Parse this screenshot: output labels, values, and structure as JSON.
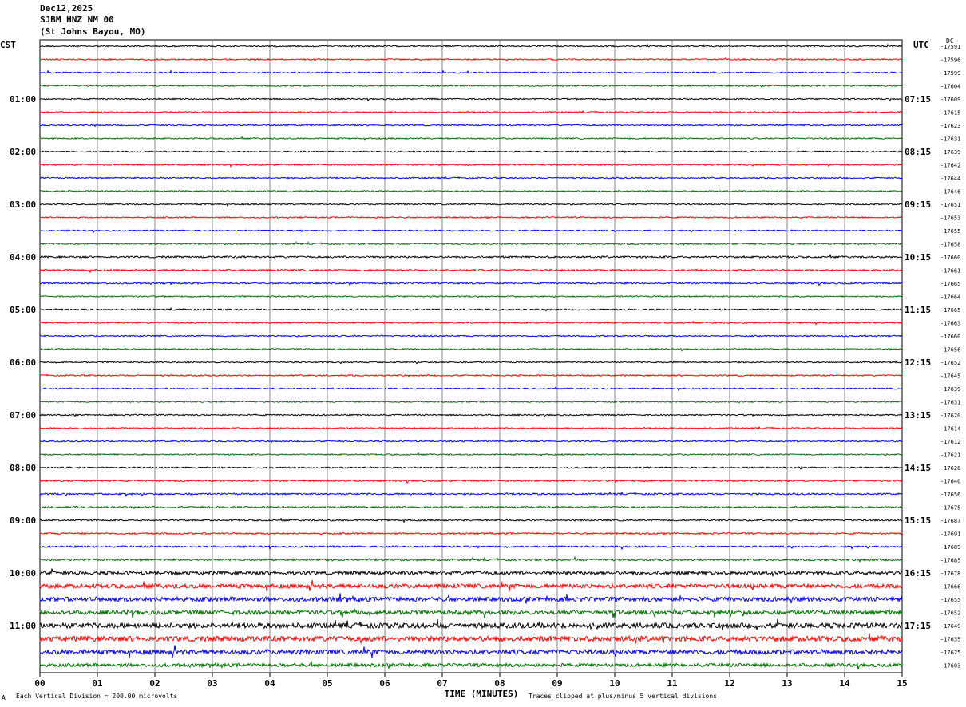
{
  "header": {
    "date": "Dec12,2025",
    "station": "SJBM HNZ NM 00",
    "location": "(St Johns Bayou, MO)"
  },
  "left_tz": "CST",
  "right_tz": "UTC",
  "right_corner_note": "DC",
  "footer": {
    "mark": "A",
    "scale": "Each Vertical Division =  200.00 microvolts",
    "xlabel": "TIME (MINUTES)",
    "clip": "Traces clipped at plus/minus 5 vertical divisions"
  },
  "chart_data": {
    "type": "line",
    "title": "",
    "x_ticks": [
      "00",
      "01",
      "02",
      "03",
      "04",
      "05",
      "06",
      "07",
      "08",
      "09",
      "10",
      "11",
      "12",
      "13",
      "14",
      "15"
    ],
    "xlim": [
      0,
      15
    ],
    "xlabel": "TIME (MINUTES)",
    "trace_colors": [
      "#000000",
      "#ff0000",
      "#0000ff",
      "#007000"
    ],
    "left_hour_labels": [
      "01:00",
      "02:00",
      "03:00",
      "04:00",
      "05:00",
      "06:00",
      "07:00",
      "08:00",
      "09:00",
      "10:00",
      "11:00"
    ],
    "right_hour_labels": [
      "07:15",
      "08:15",
      "09:15",
      "10:15",
      "11:15",
      "12:15",
      "13:15",
      "14:15",
      "15:15",
      "16:15",
      "17:15"
    ],
    "trace_offsets": [
      -17591,
      -17596,
      -17599,
      -17604,
      -17609,
      -17615,
      -17623,
      -17631,
      -17639,
      -17642,
      -17644,
      -17646,
      -17651,
      -17653,
      -17655,
      -17658,
      -17660,
      -17661,
      -17665,
      -17664,
      -17665,
      -17663,
      -17660,
      -17656,
      -17652,
      -17645,
      -17639,
      -17631,
      -17620,
      -17614,
      -17612,
      -17621,
      -17628,
      -17640,
      -17656,
      -17675,
      -17687,
      -17691,
      -17689,
      -17685,
      -17678,
      -17666,
      -17655,
      -17652,
      -17649,
      -17635,
      -17625,
      -17603
    ],
    "trace_noise_levels": [
      1,
      1,
      1,
      1,
      1,
      1,
      1,
      1,
      1,
      1,
      1,
      1,
      1,
      1,
      1,
      1.2,
      1.4,
      1.3,
      1.2,
      1,
      1.1,
      1,
      1,
      1,
      1,
      1,
      1,
      1,
      1,
      1,
      1,
      1,
      1.1,
      1.2,
      1.3,
      1.3,
      1.2,
      1.2,
      1.3,
      1.6,
      2.6,
      3.2,
      3.4,
      3.2,
      4.0,
      4.0,
      3.6,
      2.6
    ]
  }
}
